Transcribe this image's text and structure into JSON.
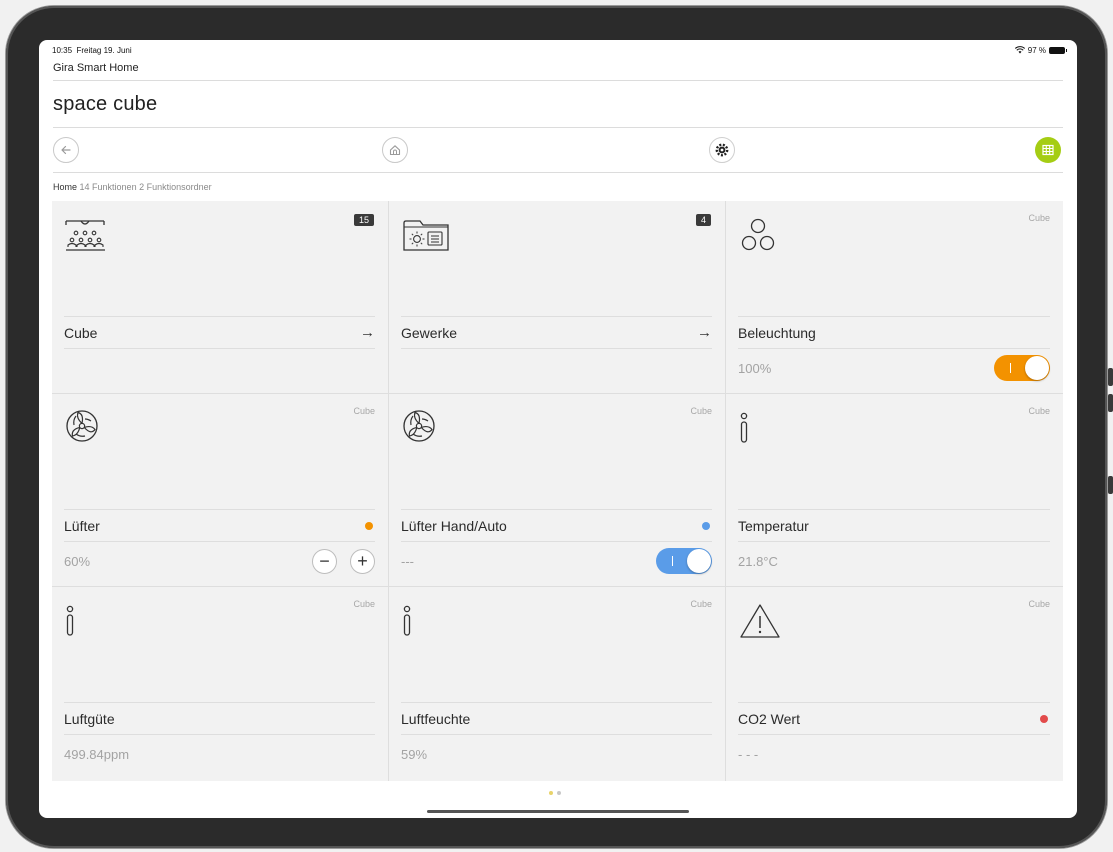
{
  "status_bar": {
    "time": "10:35",
    "date": "Freitag 19. Juni",
    "battery": "97 %"
  },
  "app": {
    "name": "Gira Smart Home"
  },
  "page": {
    "title": "space cube"
  },
  "nav": {
    "back_icon": "arrow-left-icon",
    "home_icon": "home-icon",
    "settings_icon": "gear-icon",
    "grid_icon": "grid-view-icon"
  },
  "breadcrumb": {
    "home": "Home",
    "functions": "14 Funktionen",
    "folders": "2 Funktionsordner"
  },
  "colors": {
    "accent_green": "#a5cd14",
    "orange": "#f39200",
    "blue": "#5a9ce8",
    "red": "#e24b4b",
    "tile_bg": "#f2f2f2"
  },
  "tiles": [
    {
      "icon": "room-people-icon",
      "badge": "15",
      "label": "Cube",
      "action": "arrow-right-icon"
    },
    {
      "icon": "trades-folder-icon",
      "badge": "4",
      "label": "Gewerke",
      "action": "arrow-right-icon"
    },
    {
      "icon": "lights-icon",
      "room": "Cube",
      "label": "Beleuchtung",
      "value": "100%",
      "toggle": "on"
    },
    {
      "icon": "fan-icon",
      "room": "Cube",
      "label": "Lüfter",
      "status_dot": "orange",
      "value": "60%",
      "minus": "−",
      "plus": "+"
    },
    {
      "icon": "fan-icon",
      "room": "Cube",
      "label": "Lüfter Hand/Auto",
      "status_dot": "blue",
      "value": "---",
      "toggle": "on"
    },
    {
      "icon": "info-icon",
      "room": "Cube",
      "label": "Temperatur",
      "value": "21.8°C"
    },
    {
      "icon": "info-icon",
      "room": "Cube",
      "label": "Luftgüte",
      "value": "499.84ppm"
    },
    {
      "icon": "info-icon",
      "room": "Cube",
      "label": "Luftfeuchte",
      "value": "59%"
    },
    {
      "icon": "warning-icon",
      "room": "Cube",
      "label": "CO2 Wert",
      "status_dot": "red",
      "value": "- - -"
    }
  ],
  "pager": {
    "current": 1,
    "total": 2
  }
}
